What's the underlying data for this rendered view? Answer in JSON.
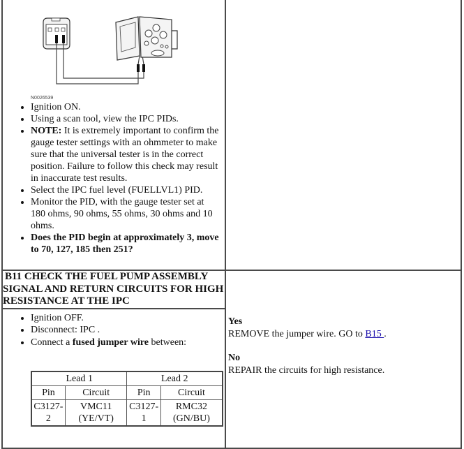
{
  "figure": {
    "id": "N0026539",
    "icons": [
      "connector-icon",
      "gauge-tester-icon",
      "test-lead-wire-icon"
    ]
  },
  "step_b10_items": [
    {
      "bold_prefix": "",
      "text": "Ignition ON."
    },
    {
      "bold_prefix": "",
      "text": "Using a scan tool, view the IPC PIDs."
    },
    {
      "bold_prefix": "NOTE:",
      "text": " It is extremely important to confirm the gauge tester settings with an ohmmeter to make sure that the universal tester is in the correct position. Failure to follow this check may result in inaccurate test results."
    },
    {
      "bold_prefix": "",
      "text": "Select the IPC fuel level (FUELLVL1) PID."
    },
    {
      "bold_prefix": "",
      "text": "Monitor the PID, with the gauge tester set at 180 ohms, 90 ohms, 55 ohms, 30 ohms and 10 ohms."
    },
    {
      "bold_prefix": "Does the PID begin at approximately 3, move to 70, 127, 185 then 251?",
      "text": ""
    }
  ],
  "step_b11": {
    "header_lines": [
      "B11 CHECK THE FUEL PUMP ASSEMBLY",
      "SIGNAL AND RETURN CIRCUITS FOR HIGH",
      "RESISTANCE AT THE IPC"
    ],
    "items": [
      {
        "pre": "Ignition OFF.",
        "bold": "",
        "post": ""
      },
      {
        "pre": "Disconnect: IPC .",
        "bold": "",
        "post": ""
      },
      {
        "pre": "Connect a ",
        "bold": "fused jumper wire",
        "post": " between:"
      }
    ],
    "leads_table": {
      "group_headers": [
        "Lead 1",
        "Lead 2"
      ],
      "column_headers": [
        "Pin",
        "Circuit",
        "Pin",
        "Circuit"
      ],
      "rows": [
        [
          "C3127-2",
          "VMC11 (YE/VT)",
          "C3127-1",
          "RMC32 (GN/BU)"
        ]
      ]
    },
    "results": {
      "yes_label": "Yes",
      "yes_text": "REMOVE the jumper wire. GO to ",
      "yes_link": "B15 ",
      "yes_suffix": ".",
      "no_label": "No",
      "no_text": "REPAIR the circuits for high resistance."
    }
  }
}
